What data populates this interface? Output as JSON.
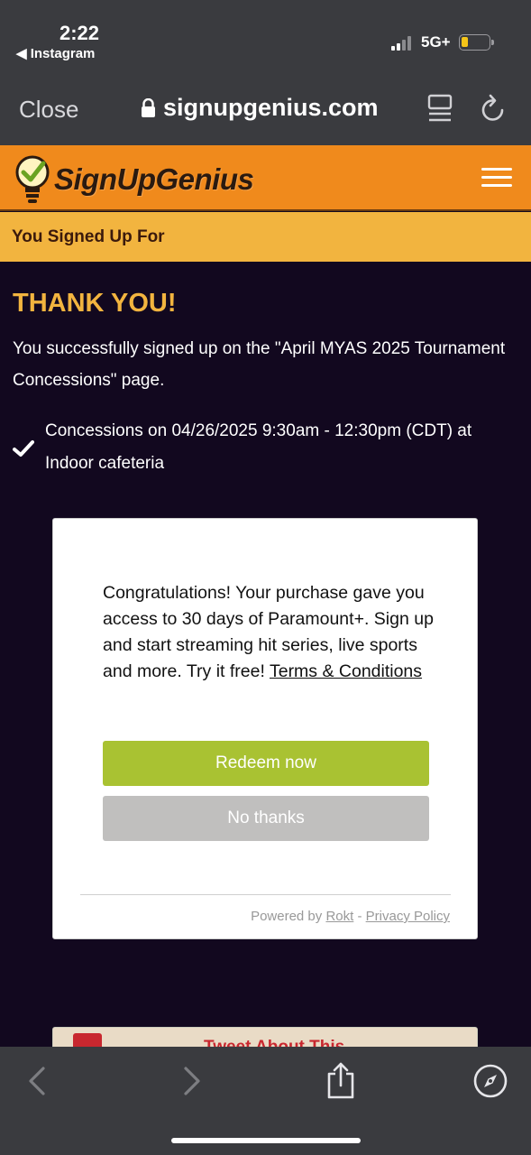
{
  "status_bar": {
    "time": "2:22",
    "back_app": "◀ Instagram",
    "network": "5G+"
  },
  "browser": {
    "close_label": "Close",
    "url": "signupgenius.com"
  },
  "site": {
    "logo_text": "SignUpGenius",
    "strip_title": "You Signed Up For"
  },
  "content": {
    "heading": "THANK YOU!",
    "message": "You successfully signed up on the \"April MYAS 2025 Tournament Concessions\" page.",
    "slot": "Concessions on 04/26/2025 9:30am - 12:30pm (CDT) at Indoor cafeteria"
  },
  "offer": {
    "text": "Congratulations! Your purchase gave you access to 30 days of Paramount+. Sign up and start streaming hit series, live sports and more. Try it free! ",
    "terms_link": "Terms & Conditions",
    "redeem_label": "Redeem now",
    "decline_label": "No thanks",
    "powered_by": "Powered by ",
    "rokt_link": "Rokt",
    "separator": " - ",
    "privacy_link": "Privacy Policy"
  },
  "tweet": {
    "label": "Tweet About This"
  },
  "colors": {
    "header_orange": "#f08a1c",
    "strip_yellow": "#f2b43f",
    "page_bg": "#12081f",
    "redeem_green": "#a9c232",
    "decline_gray": "#c0bfbe",
    "tweet_red": "#c8272f"
  }
}
